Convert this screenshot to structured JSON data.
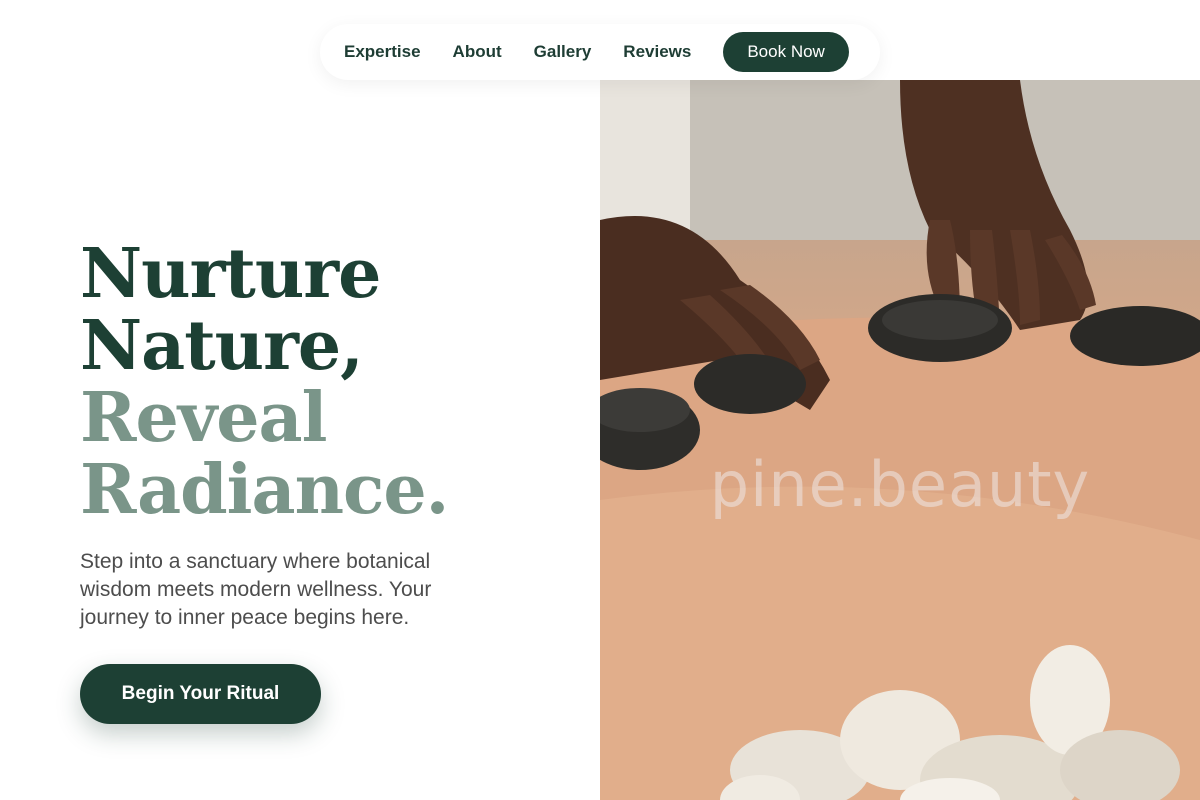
{
  "nav": {
    "links": [
      "Expertise",
      "About",
      "Gallery",
      "Reviews"
    ],
    "cta_label": "Book Now"
  },
  "hero": {
    "headline_line1": "Nurture",
    "headline_line2": "Nature,",
    "headline_line3": "Reveal",
    "headline_line4": "Radiance.",
    "subtext": "Step into a sanctuary where botanical wisdom meets modern wellness. Your journey to inner peace begins here.",
    "cta_label": "Begin Your Ritual",
    "image_watermark": "pine.beauty"
  },
  "colors": {
    "primary": "#1d4034",
    "headline_accent": "#7a9589",
    "body_text": "#4d4d4d",
    "background": "#ffffff"
  }
}
